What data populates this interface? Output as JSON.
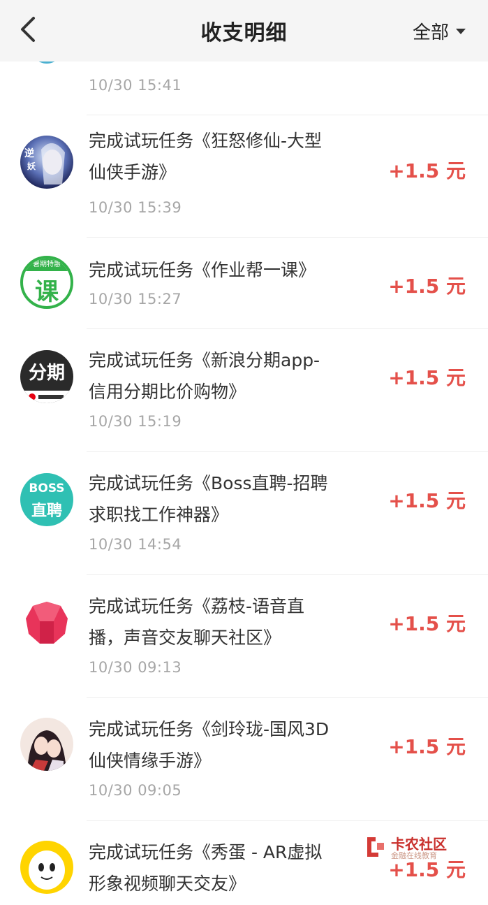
{
  "header": {
    "title": "收支明细",
    "filter_label": "全部"
  },
  "partial_top": {
    "date": "10/30 15:41"
  },
  "records": [
    {
      "line1": "完成试玩任务《狂怒修仙-大型",
      "line2": "仙侠手游》",
      "date": "10/30 15:39",
      "amount": "+1.5 元",
      "icon": "fantasy-game-icon"
    },
    {
      "line1": "完成试玩任务《作业帮一课》",
      "line2": "",
      "date": "10/30 15:27",
      "amount": "+1.5 元",
      "icon": "course-app-icon",
      "icon_text": "课",
      "icon_badge": "暑期特惠"
    },
    {
      "line1": "完成试玩任务《新浪分期app-",
      "line2": "信用分期比价购物》",
      "date": "10/30 15:19",
      "amount": "+1.5 元",
      "icon": "sina-installment-icon",
      "icon_text": "分期"
    },
    {
      "line1": "完成试玩任务《Boss直聘-招聘",
      "line2": "求职找工作神器》",
      "date": "10/30 14:54",
      "amount": "+1.5 元",
      "icon": "boss-zhipin-icon",
      "icon_text_top": "BOSS",
      "icon_text_bottom": "直聘"
    },
    {
      "line1": "完成试玩任务《荔枝-语音直",
      "line2": "播，声音交友聊天社区》",
      "date": "10/30 09:13",
      "amount": "+1.5 元",
      "icon": "lychee-app-icon"
    },
    {
      "line1": "完成试玩任务《剑玲珑-国风3D",
      "line2": "仙侠情缘手游》",
      "date": "10/30 09:05",
      "amount": "+1.5 元",
      "icon": "wuxia-game-icon"
    },
    {
      "line1": "完成试玩任务《秀蛋 - AR虚拟",
      "line2": "形象视频聊天交友》",
      "date": "",
      "amount": "+1.5 元",
      "icon": "xiudan-egg-icon"
    }
  ],
  "watermark": {
    "brand": "卡农社区",
    "tagline": "金融在线教育"
  },
  "colors": {
    "amount": "#e4504a",
    "header_bg": "#f5f5f5",
    "date": "#a6a6a6"
  }
}
